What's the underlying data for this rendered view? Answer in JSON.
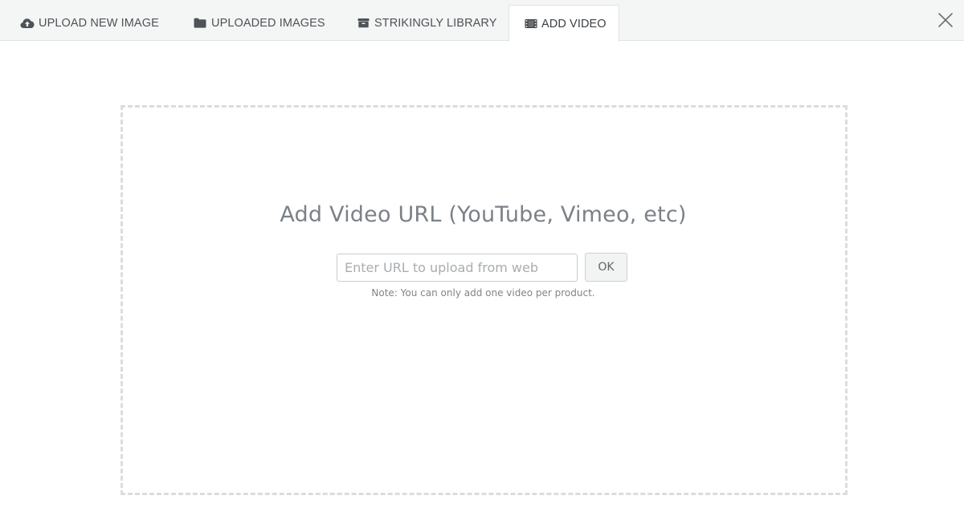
{
  "tabs": [
    {
      "label": "UPLOAD NEW IMAGE",
      "icon": "cloud-upload-icon",
      "active": false
    },
    {
      "label": "UPLOADED IMAGES",
      "icon": "folder-icon",
      "active": false
    },
    {
      "label": "STRIKINGLY LIBRARY",
      "icon": "archive-box-icon",
      "active": false
    },
    {
      "label": "ADD VIDEO",
      "icon": "film-icon",
      "active": true
    }
  ],
  "close_icon": "close-icon",
  "main": {
    "headline": "Add Video URL (YouTube, Vimeo, etc)",
    "url_input": {
      "placeholder": "Enter URL to upload from web",
      "value": ""
    },
    "ok_label": "OK",
    "note": "Note: You can only add one video per product."
  },
  "colors": {
    "tabbar_bg": "#f4f5f5",
    "dropzone_border": "#dcdcdc",
    "headline": "#7b8188"
  }
}
